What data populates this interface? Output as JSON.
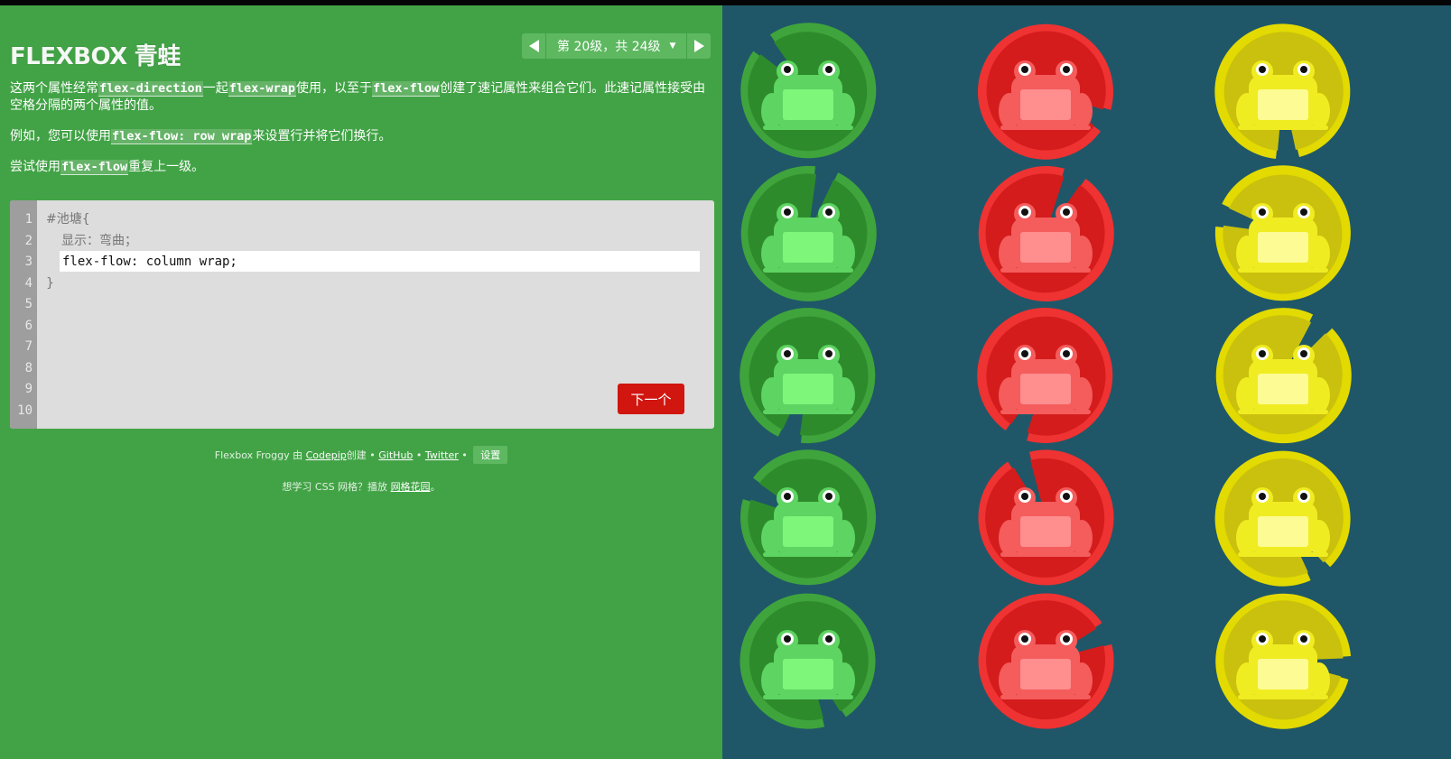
{
  "app": {
    "logo_main": "FLEXBOX",
    "logo_cn": "青蛙"
  },
  "level_nav": {
    "indicator": "第 20级，共 24级",
    "caret": "▼",
    "prev_icon": "triangle-left-icon",
    "next_icon": "triangle-right-icon"
  },
  "instructions": {
    "p1": {
      "t1": "这两个属性经常",
      "c1": "flex-direction",
      "t2": "一起",
      "c2": "flex-wrap",
      "t3": "使用，以至于",
      "c3": "flex-flow",
      "t4": "创建了速记属性来组合它们。此速记属性接受由空格分隔的两个属性的值。"
    },
    "p2": {
      "t1": "例如，您可以使用",
      "c1": "flex-flow: row wrap",
      "t2": "来设置行并将它们换行。"
    },
    "p3": {
      "t1": "尝试使用",
      "c1": "flex-flow",
      "t2": "重复上一级。"
    }
  },
  "editor": {
    "line_numbers": [
      "1",
      "2",
      "3",
      "4",
      "5",
      "6",
      "7",
      "8",
      "9",
      "10"
    ],
    "line1": "#池塘{",
    "line2": "显示：弯曲；",
    "input_value": "flex-flow: column wrap;",
    "line4": "}",
    "next_button": "下一个"
  },
  "credits": {
    "prefix": "Flexbox Froggy 由 ",
    "codepip": "Codepip",
    "created": "创建",
    "sep": " • ",
    "github": "GitHub",
    "twitter": "Twitter",
    "settings": "设置"
  },
  "promo": {
    "text": "想学习 CSS 网格？播放 ",
    "link": "网格花园",
    "suffix": "。"
  },
  "colors": {
    "sidebar_bg": "#42a346",
    "pond_bg": "#1f5768",
    "green_pad": "#2e8b2b",
    "red_pad": "#d41c1c",
    "yellow_pad": "#c9c10d",
    "next_button": "#d1150f"
  },
  "pond": {
    "columns": [
      {
        "color": "green",
        "frogs": 5
      },
      {
        "color": "red",
        "frogs": 5
      },
      {
        "color": "yellow",
        "frogs": 5
      }
    ]
  }
}
